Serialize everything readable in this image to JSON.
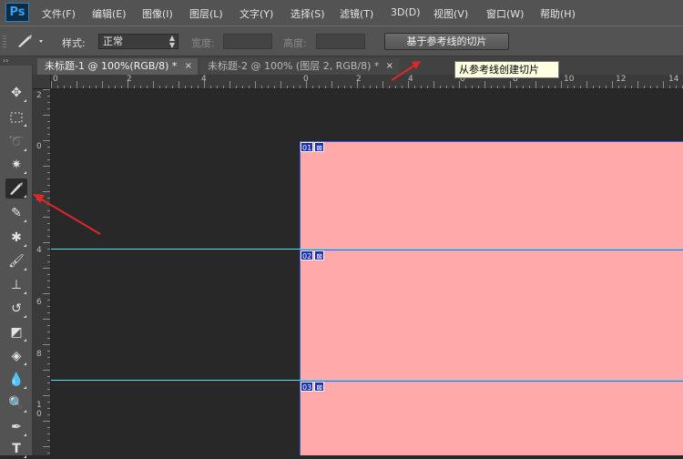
{
  "app": {
    "logo": "Ps"
  },
  "menu": {
    "items": [
      "文件(F)",
      "编辑(E)",
      "图像(I)",
      "图层(L)",
      "文字(Y)",
      "选择(S)",
      "滤镜(T)",
      "3D(D)",
      "视图(V)",
      "窗口(W)",
      "帮助(H)"
    ]
  },
  "options": {
    "style_label": "样式:",
    "style_value": "正常",
    "width_label": "宽度:",
    "height_label": "高度:",
    "slice_button": "基于参考线的切片"
  },
  "tooltip": "从参考线创建切片",
  "tabs": [
    {
      "label": "未标题-1 @ 100%(RGB/8) *",
      "close": "×"
    },
    {
      "label": "未标题-2 @ 100% (图层 2, RGB/8) *",
      "close": "×"
    }
  ],
  "ruler": {
    "h_labels": [
      "0",
      "2",
      "4",
      "0",
      "2",
      "4",
      "6",
      "8",
      "10",
      "12",
      "14"
    ],
    "v_labels": [
      "2",
      "0",
      "2",
      "4",
      "6",
      "8",
      "1",
      "0"
    ]
  },
  "slices": [
    {
      "number": "01"
    },
    {
      "number": "02"
    },
    {
      "number": "03"
    }
  ],
  "colors": {
    "document": "#ffa9ab",
    "guide": "#5ee0f3",
    "slice_line": "#3d5fe6",
    "arrow": "#e0262a"
  },
  "tools": [
    "move-icon",
    "marquee-icon",
    "lasso-icon",
    "magic-wand-icon",
    "slice-icon",
    "eyedropper-icon",
    "healing-brush-icon",
    "brush-icon",
    "clone-stamp-icon",
    "history-brush-icon",
    "eraser-icon",
    "paint-bucket-icon",
    "blur-icon",
    "dodge-icon",
    "pen-icon",
    "type-icon"
  ]
}
